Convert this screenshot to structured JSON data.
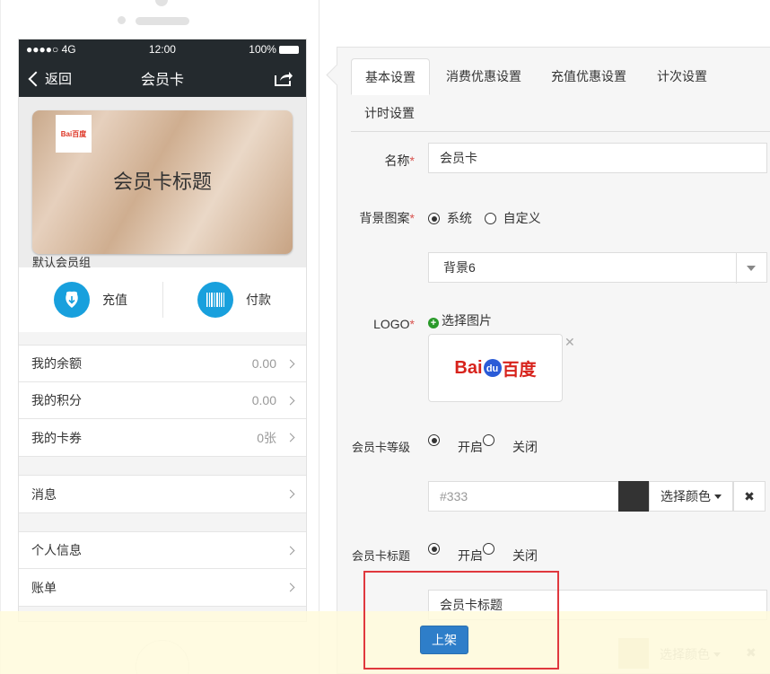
{
  "phone": {
    "status": {
      "signal": "●●●●○ 4G",
      "time": "12:00",
      "battery": "100%"
    },
    "nav": {
      "back_label": "返回",
      "title": "会员卡"
    },
    "card": {
      "logo_text": "Bai百度",
      "title": "会员卡标题",
      "group": "默认会员组"
    },
    "actions": [
      {
        "label": "充值",
        "icon": "download-icon"
      },
      {
        "label": "付款",
        "icon": "barcode-icon"
      }
    ],
    "list1": [
      {
        "label": "我的余额",
        "value": "0.00"
      },
      {
        "label": "我的积分",
        "value": "0.00"
      },
      {
        "label": "我的卡券",
        "value": "0张"
      }
    ],
    "list2": [
      {
        "label": "消息"
      }
    ],
    "list3": [
      {
        "label": "个人信息"
      },
      {
        "label": "账单"
      }
    ]
  },
  "tabs": [
    {
      "label": "基本设置",
      "active": true
    },
    {
      "label": "消费优惠设置"
    },
    {
      "label": "充值优惠设置"
    },
    {
      "label": "计次设置"
    },
    {
      "label": "计时设置"
    }
  ],
  "form": {
    "name": {
      "label": "名称",
      "value": "会员卡"
    },
    "background": {
      "label": "背景图案",
      "option_system": "系统",
      "option_custom": "自定义",
      "select_value": "背景6"
    },
    "logo": {
      "label": "LOGO",
      "choose_label": "选择图片",
      "preview_text_red": "Bai",
      "preview_text_red2": "百度",
      "preview_text_blue": "du"
    },
    "level": {
      "label": "会员卡等级",
      "on": "开启",
      "off": "关闭",
      "color_value": "#333",
      "choose_color": "选择颜色"
    },
    "title": {
      "label": "会员卡标题",
      "on": "开启",
      "off": "关闭",
      "value": "会员卡标题",
      "choose_color": "选择颜色"
    }
  },
  "bottom": {
    "publish_label": "上架"
  },
  "colors": {
    "accent": "#18a0dd",
    "dark_bar": "#242a2e",
    "primary_button": "#2e7ec9",
    "highlight": "#e0383e",
    "swatch_dark": "#333333",
    "swatch_light": "#d8d4b8"
  }
}
